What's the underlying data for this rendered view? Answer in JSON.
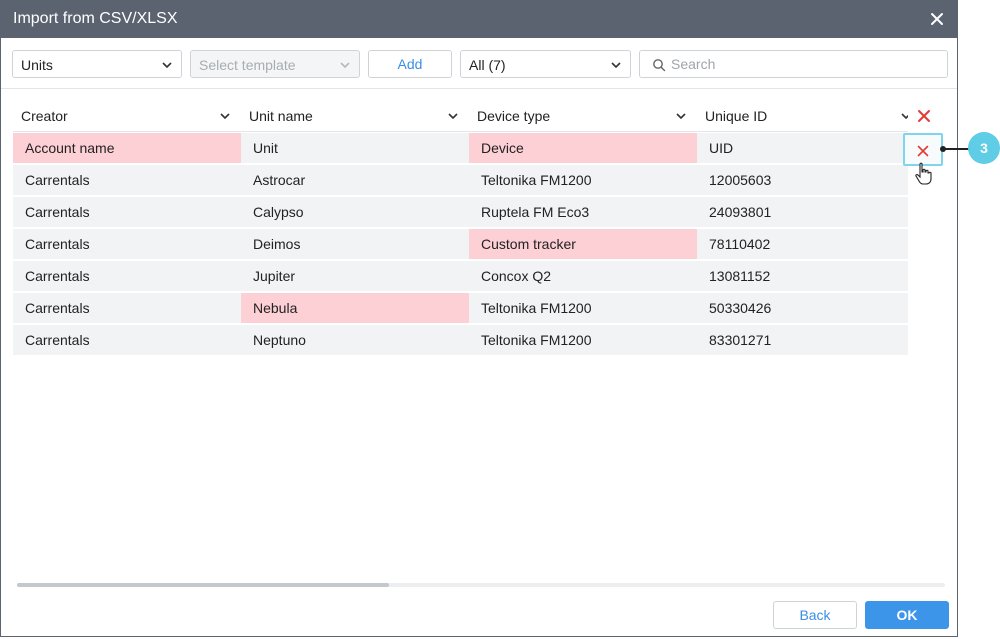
{
  "window": {
    "title": "Import from CSV/XLSX"
  },
  "toolbar": {
    "type_select": "Units",
    "template_select_placeholder": "Select template",
    "add_label": "Add",
    "filter_select": "All (7)",
    "search_placeholder": "Search"
  },
  "table": {
    "columns": [
      "Creator",
      "Unit name",
      "Device type",
      "Unique ID"
    ],
    "header_row": {
      "cells": [
        "Account name",
        "Unit",
        "Device",
        "UID"
      ],
      "errors": [
        true,
        false,
        true,
        false
      ]
    },
    "rows": [
      {
        "cells": [
          "Carrentals",
          "Astrocar",
          "Teltonika FM1200",
          "12005603"
        ],
        "errors": [
          false,
          false,
          false,
          false
        ]
      },
      {
        "cells": [
          "Carrentals",
          "Calypso",
          "Ruptela FM Eco3",
          "24093801"
        ],
        "errors": [
          false,
          false,
          false,
          false
        ]
      },
      {
        "cells": [
          "Carrentals",
          "Deimos",
          "Custom tracker",
          "78110402"
        ],
        "errors": [
          false,
          false,
          true,
          false
        ]
      },
      {
        "cells": [
          "Carrentals",
          "Jupiter",
          "Concox Q2",
          "13081152"
        ],
        "errors": [
          false,
          false,
          false,
          false
        ]
      },
      {
        "cells": [
          "Carrentals",
          "Nebula",
          "Teltonika FM1200",
          "50330426"
        ],
        "errors": [
          false,
          true,
          false,
          false
        ]
      },
      {
        "cells": [
          "Carrentals",
          "Neptuno",
          "Teltonika FM1200",
          "83301271"
        ],
        "errors": [
          false,
          false,
          false,
          false
        ]
      }
    ]
  },
  "callout": {
    "label": "3"
  },
  "footer": {
    "back_label": "Back",
    "ok_label": "OK"
  },
  "colors": {
    "titlebar": "#5b6270",
    "error_cell": "#fdd0d6",
    "accent": "#3d95ea",
    "callout": "#5fcde6",
    "delete_icon": "#e53935"
  },
  "icons": {
    "close": "close-icon",
    "delete": "delete-x-icon",
    "search": "search-icon",
    "cursor": "hand-pointer-icon"
  }
}
